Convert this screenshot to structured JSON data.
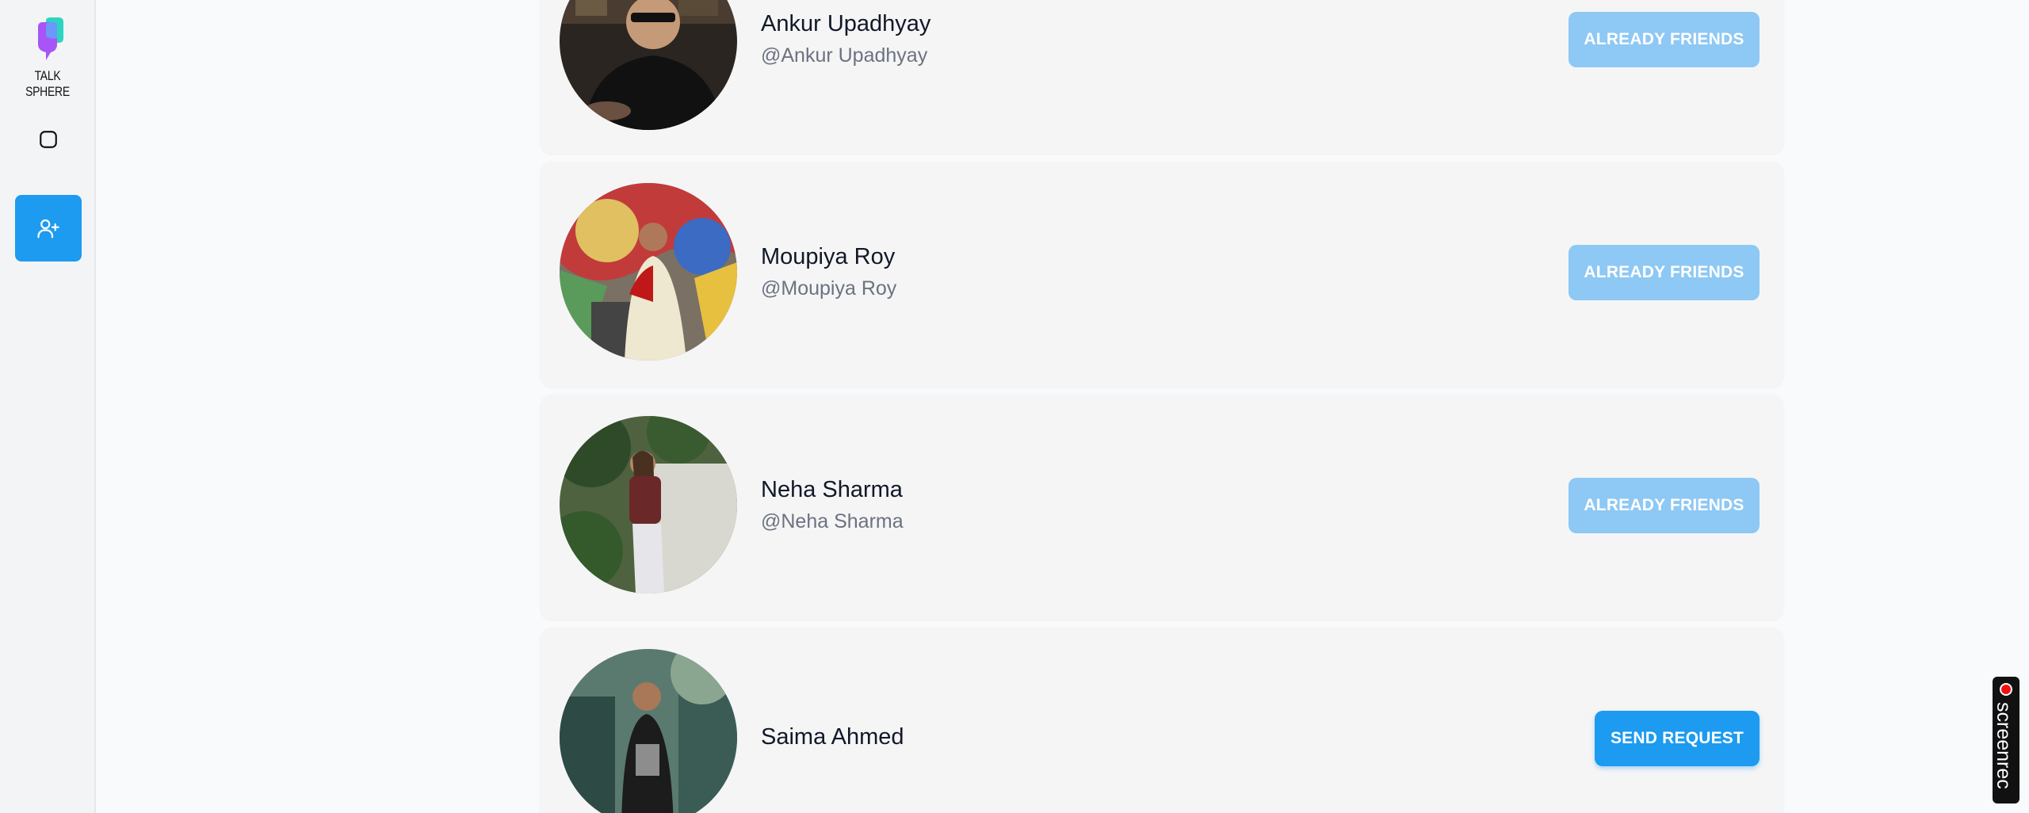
{
  "app": {
    "name": "TALK SPHERE"
  },
  "nav": {
    "items": [
      {
        "name": "chats",
        "icon": "chat-bubble-icon",
        "active": false
      },
      {
        "name": "add-friend",
        "icon": "user-plus-icon",
        "active": true
      }
    ]
  },
  "users": [
    {
      "name": "Ankur Upadhyay",
      "handle": "@Ankur Upadhyay",
      "action": "ALREADY FRIENDS",
      "status": "friends"
    },
    {
      "name": "Moupiya Roy",
      "handle": "@Moupiya Roy",
      "action": "ALREADY FRIENDS",
      "status": "friends"
    },
    {
      "name": "Neha Sharma",
      "handle": "@Neha Sharma",
      "action": "ALREADY FRIENDS",
      "status": "friends"
    },
    {
      "name": "Saima Ahmed",
      "handle": "",
      "action": "SEND REQUEST",
      "status": "not-friends"
    }
  ],
  "colors": {
    "accent": "#1d9bf0",
    "accent_disabled": "#8ec8f4"
  },
  "overlay": {
    "recorder_label": "screenrec"
  }
}
